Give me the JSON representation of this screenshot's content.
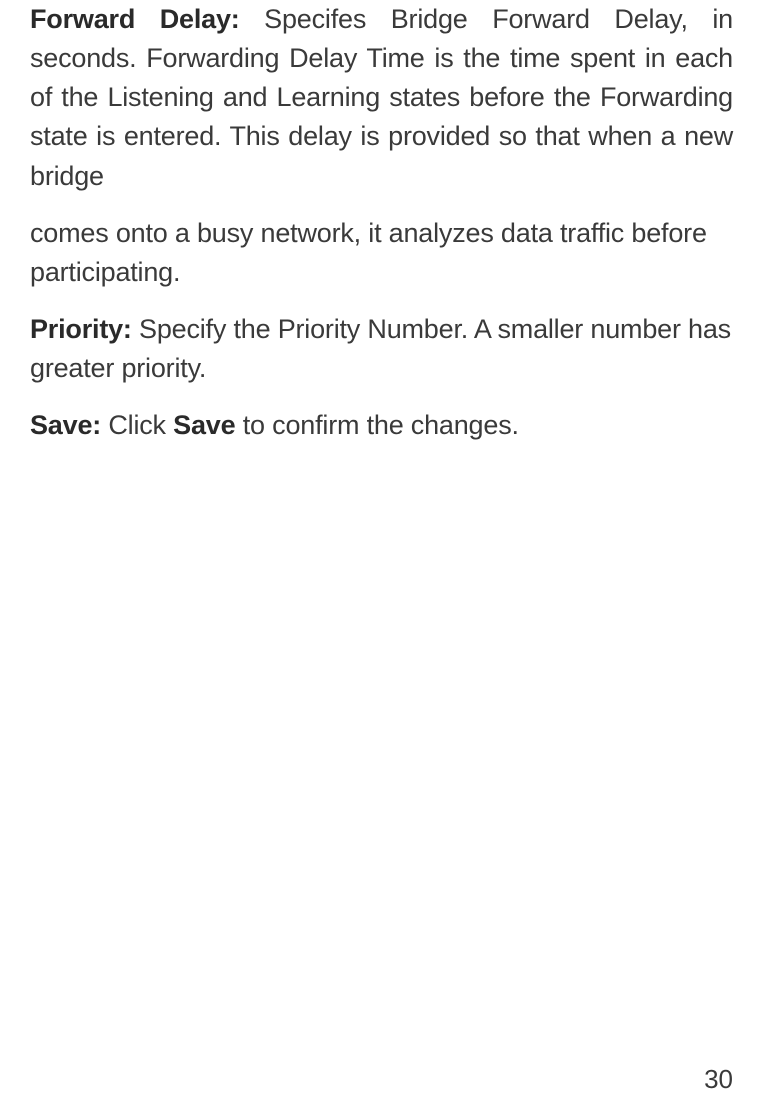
{
  "paragraphs": {
    "p1": {
      "label": "Forward Delay:",
      "text": " Specifes Bridge Forward Delay, in seconds. Forwarding Delay Time is the time spent in each of the Listening and Learning states before the Forwarding state is entered. This delay is provided so that when a new bridge"
    },
    "p2": {
      "text": "comes onto a busy network, it analyzes data traffic before participating."
    },
    "p3": {
      "label": "Priority:",
      "text": " Specify the Priority Number. A smaller number has greater priority."
    },
    "p4": {
      "label": "Save:",
      "text_before": " Click ",
      "bold_word": "Save",
      "text_after": " to confirm the changes."
    }
  },
  "page_number": "30"
}
